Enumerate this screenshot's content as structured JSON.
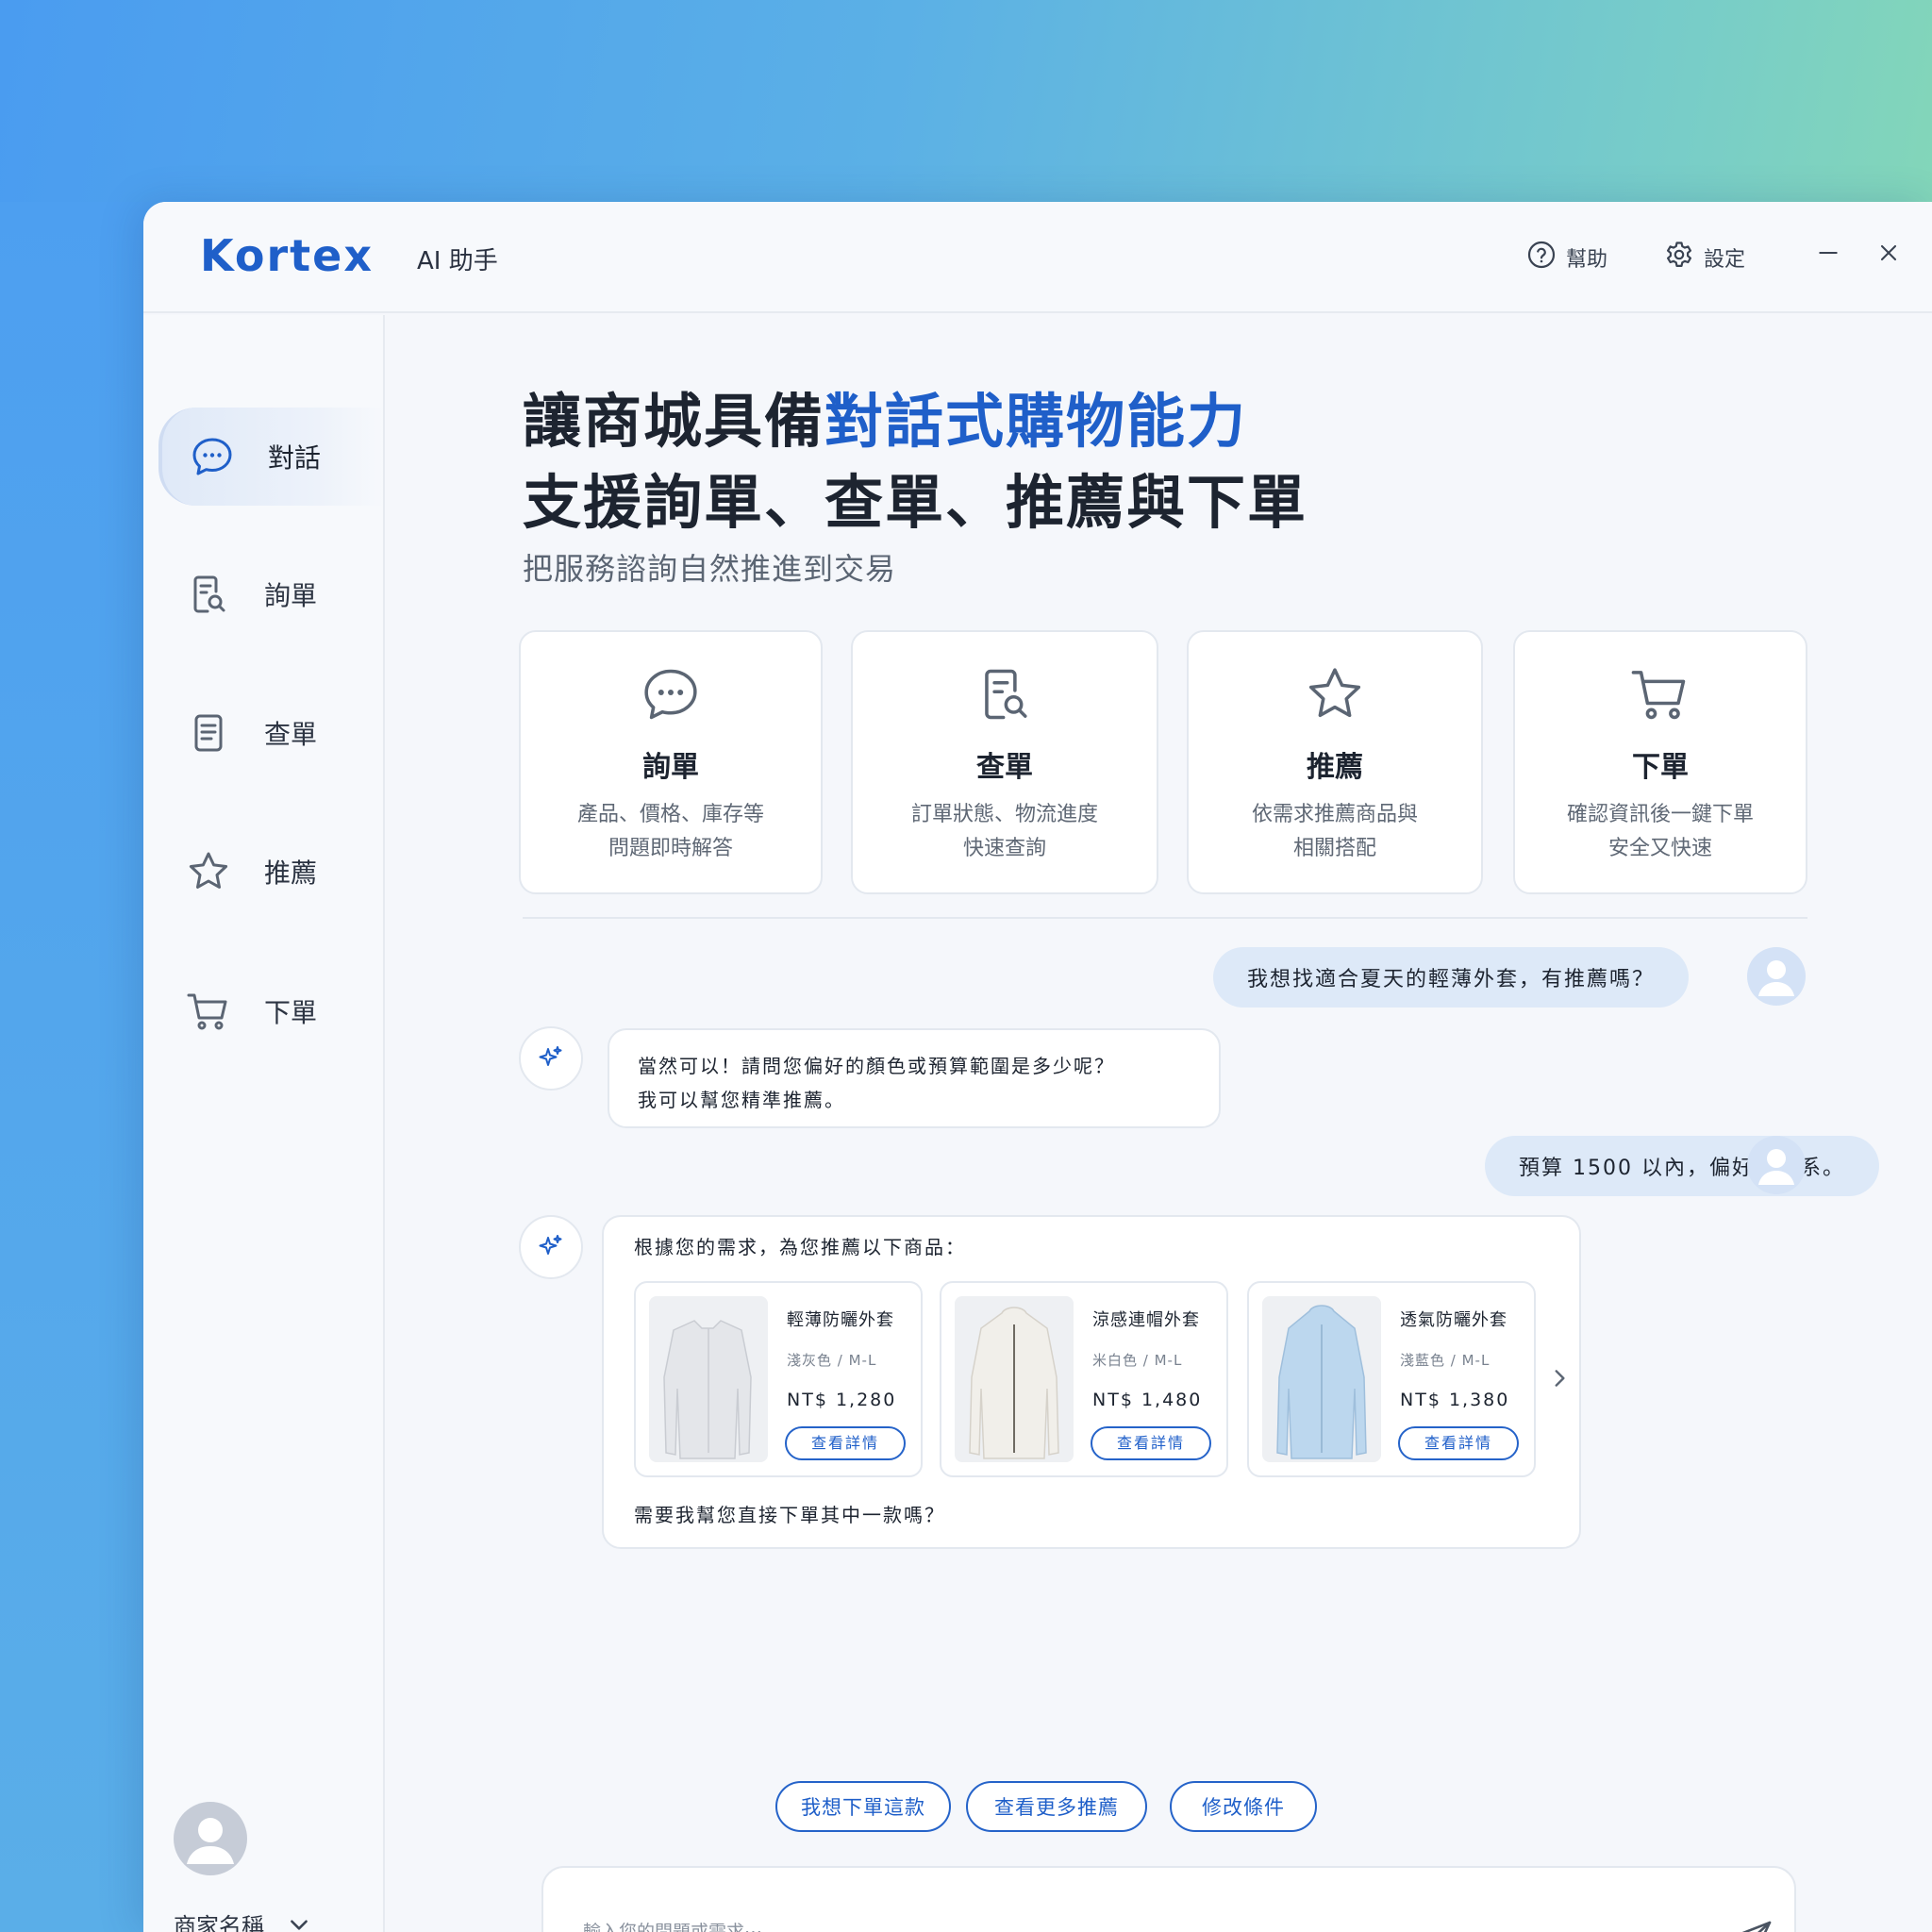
{
  "titlebar": {
    "logo": "Kortex",
    "subtitle": "AI 助手",
    "help_label": "幫助",
    "settings_label": "設定"
  },
  "sidebar": {
    "items": [
      {
        "label": "對話",
        "icon": "chat-icon",
        "active": true
      },
      {
        "label": "詢單",
        "icon": "doc-search-icon",
        "active": false
      },
      {
        "label": "查單",
        "icon": "document-icon",
        "active": false
      },
      {
        "label": "推薦",
        "icon": "star-icon",
        "active": false
      },
      {
        "label": "下單",
        "icon": "cart-icon",
        "active": false
      }
    ],
    "merchant_name": "商家名稱"
  },
  "hero": {
    "line1_plain": "讓商城具備",
    "line1_accent": "對話式購物能力",
    "line2": "支援詢單、查單、推薦與下單",
    "subtitle": "把服務諮詢自然推進到交易"
  },
  "features": [
    {
      "title": "詢單",
      "desc1": "產品、價格、庫存等",
      "desc2": "問題即時解答",
      "icon": "chat-icon"
    },
    {
      "title": "查單",
      "desc1": "訂單狀態、物流進度",
      "desc2": "快速查詢",
      "icon": "doc-search-icon"
    },
    {
      "title": "推薦",
      "desc1": "依需求推薦商品與",
      "desc2": "相關搭配",
      "icon": "star-icon"
    },
    {
      "title": "下單",
      "desc1": "確認資訊後一鍵下單",
      "desc2": "安全又快速",
      "icon": "cart-icon"
    }
  ],
  "chat": {
    "user_msg_1": "我想找適合夏天的輕薄外套，有推薦嗎？",
    "bot_msg_1_line1": "當然可以！請問您偏好的顏色或預算範圍是多少呢？",
    "bot_msg_1_line2": "我可以幫您精準推薦。",
    "user_msg_2": "預算 1500 以內，偏好淺色系。",
    "bot_msg_2_intro": "根據您的需求，為您推薦以下商品：",
    "bot_msg_2_outro": "需要我幫您直接下單其中一款嗎？",
    "products": [
      {
        "name": "輕薄防曬外套",
        "color": "淺灰色 / M-L",
        "price": "NT$ 1,280",
        "button": "查看詳情",
        "swatch": "#e4e6ea"
      },
      {
        "name": "涼感連帽外套",
        "color": "米白色 / M-L",
        "price": "NT$ 1,480",
        "button": "查看詳情",
        "swatch": "#f1efea"
      },
      {
        "name": "透氣防曬外套",
        "color": "淺藍色 / M-L",
        "price": "NT$ 1,380",
        "button": "查看詳情",
        "swatch": "#bcd7ee"
      }
    ],
    "quick_replies": [
      "我想下單這款",
      "查看更多推薦",
      "修改條件"
    ]
  },
  "input": {
    "placeholder": "輸入您的問題或需求⋯"
  },
  "colors": {
    "accent": "#1f5fc9",
    "user_bubble": "#dde9f8"
  }
}
